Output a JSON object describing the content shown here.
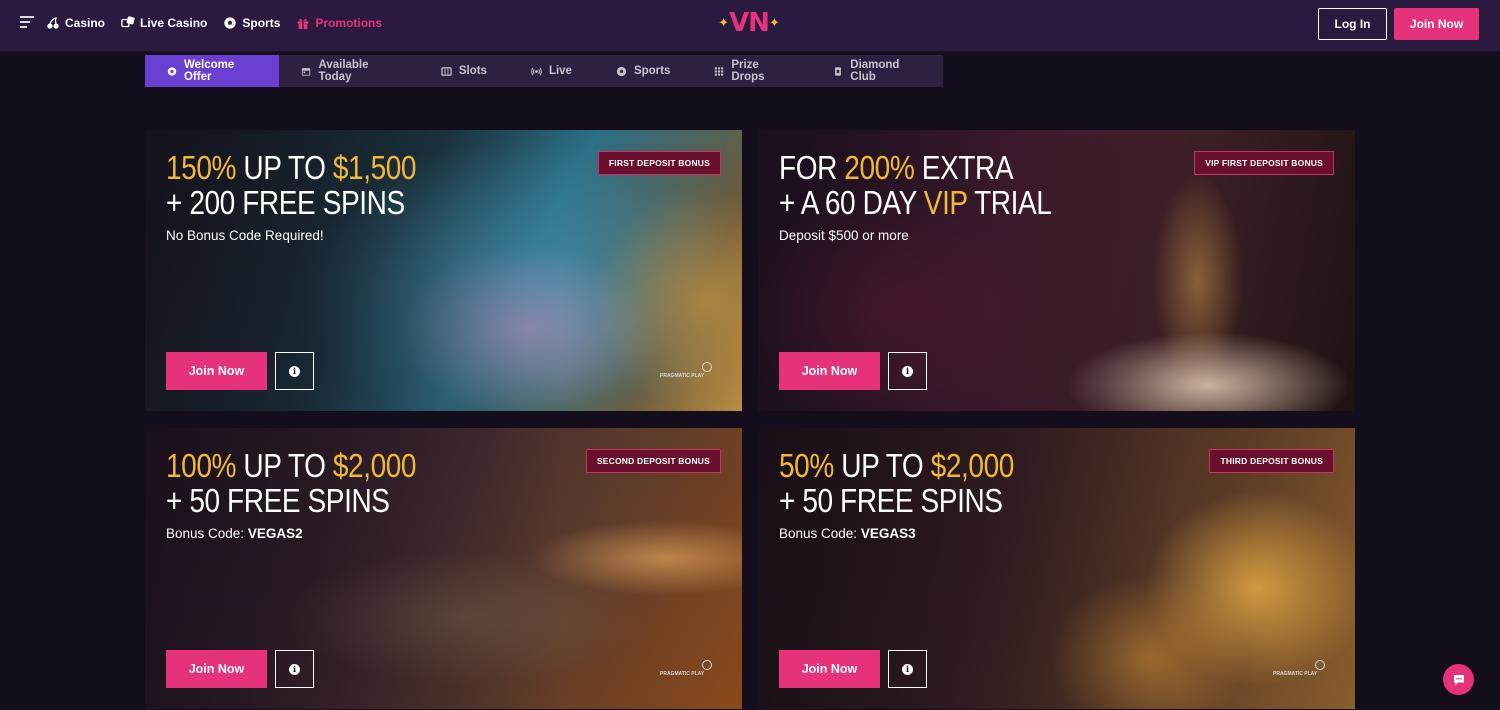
{
  "header": {
    "nav": [
      {
        "label": "Casino",
        "icon": "cherries-icon"
      },
      {
        "label": "Live Casino",
        "icon": "dice-icon"
      },
      {
        "label": "Sports",
        "icon": "soccer-ball-icon"
      },
      {
        "label": "Promotions",
        "icon": "gift-icon"
      }
    ],
    "logo_text": "VN",
    "login_label": "Log In",
    "join_label": "Join Now"
  },
  "tabs": [
    {
      "label": "Welcome Offer",
      "icon": "gear-badge-icon"
    },
    {
      "label": "Available Today",
      "icon": "calendar-icon"
    },
    {
      "label": "Slots",
      "icon": "slot-machine-icon"
    },
    {
      "label": "Live",
      "icon": "broadcast-icon"
    },
    {
      "label": "Sports",
      "icon": "soccer-ball-icon"
    },
    {
      "label": "Prize Drops",
      "icon": "grid-icon"
    },
    {
      "label": "Diamond Club",
      "icon": "card-icon"
    }
  ],
  "promos": [
    {
      "line1_gold": "150%",
      "line1_mid": " UP TO ",
      "line1_gold2": "$1,500",
      "line2": "+ 200 FREE SPINS",
      "sub": "No Bonus Code Required!",
      "badge": "FIRST DEPOSIT BONUS",
      "join": "Join Now",
      "provider": "PRAGMATIC PLAY"
    },
    {
      "line1_pre": "FOR ",
      "line1_gold": "200%",
      "line1_mid": " EXTRA",
      "line2_pre": "+ A 60 DAY ",
      "line2_gold": "VIP",
      "line2_post": " TRIAL",
      "sub": "Deposit $500 or more",
      "badge": "VIP FIRST DEPOSIT BONUS",
      "join": "Join Now"
    },
    {
      "line1_gold": "100%",
      "line1_mid": " UP TO ",
      "line1_gold2": "$2,000",
      "line2": "+ 50 FREE SPINS",
      "sub_label": "Bonus Code: ",
      "sub_code": "VEGAS2",
      "badge": "SECOND DEPOSIT BONUS",
      "join": "Join Now",
      "provider": "PRAGMATIC PLAY"
    },
    {
      "line1_gold": "50%",
      "line1_mid": " UP TO ",
      "line1_gold2": "$2,000",
      "line2": "+ 50 FREE SPINS",
      "sub_label": "Bonus Code: ",
      "sub_code": "VEGAS3",
      "badge": "THIRD DEPOSIT BONUS",
      "join": "Join Now",
      "provider": "PRAGMATIC PLAY"
    }
  ],
  "colors": {
    "accent": "#e5327a",
    "gold": "#f0b83a",
    "tab_active": "#6a3fd1",
    "header": "#2a1a3f"
  }
}
